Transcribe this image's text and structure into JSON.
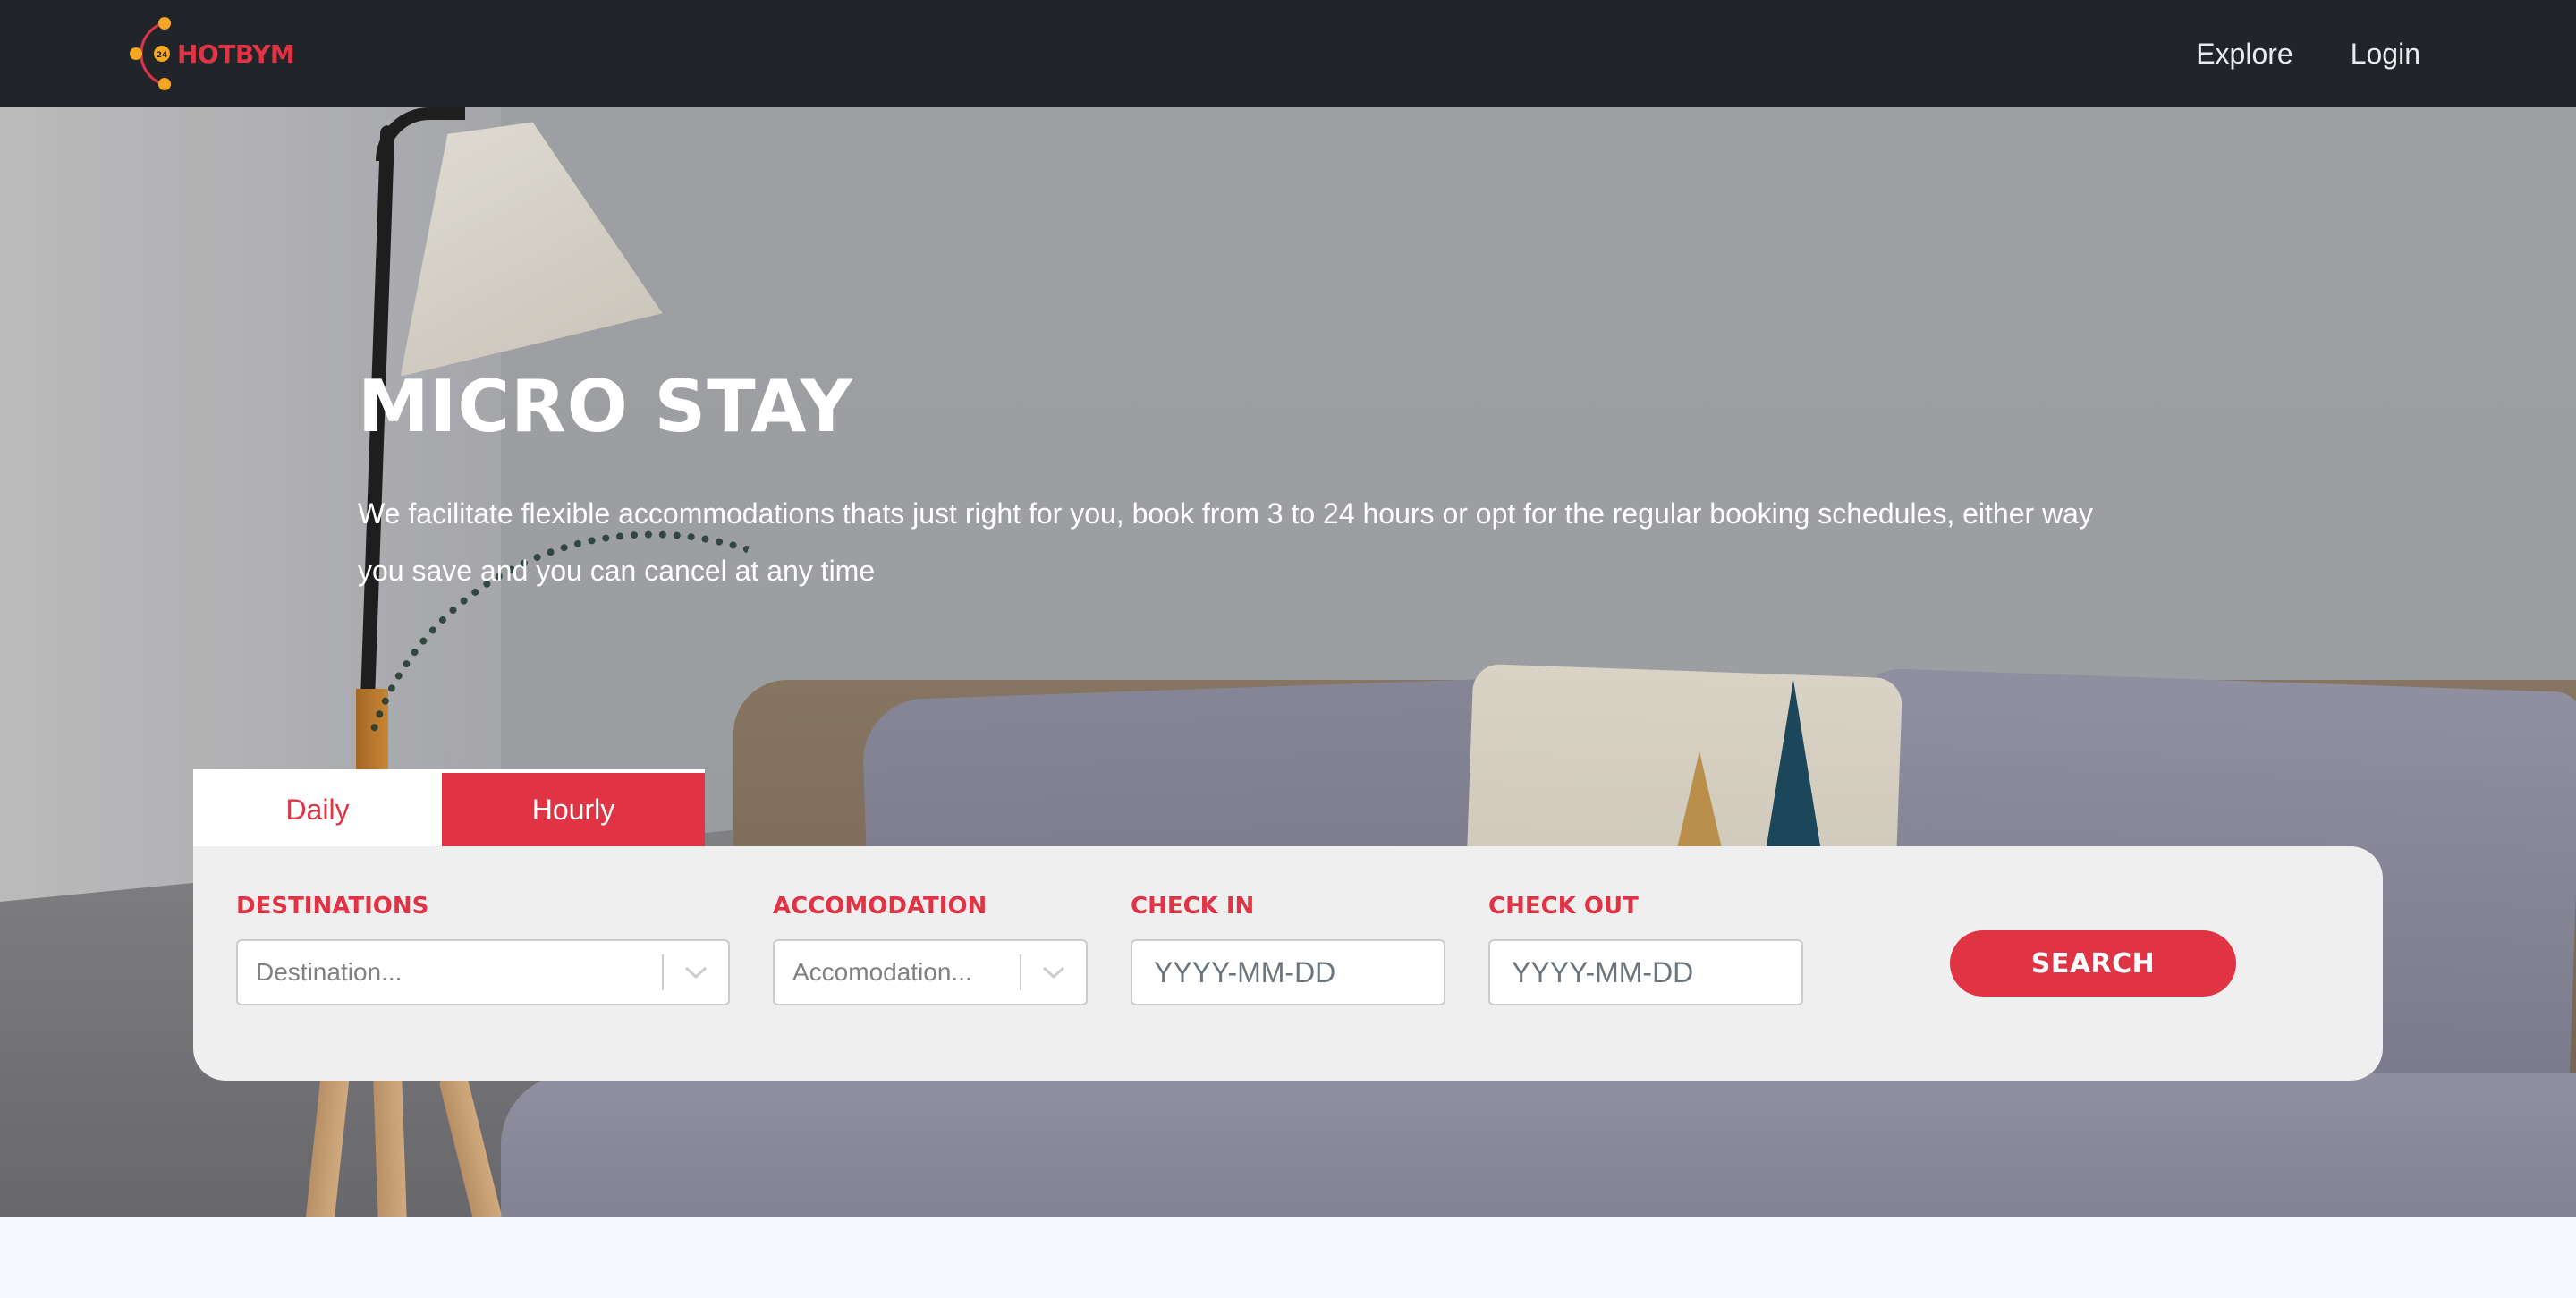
{
  "brand": {
    "name": "HOTBYM",
    "logo_center_text": "24",
    "colors": {
      "primary": "#e03444",
      "logo_accent": "#f5a623",
      "navbar": "#212429"
    }
  },
  "nav": {
    "explore_label": "Explore",
    "login_label": "Login"
  },
  "hero": {
    "title": "MICRO STAY",
    "description": "We facilitate flexible accommodations thats just right for you, book from 3 to 24 hours or opt for the regular booking schedules, either way you save and you can cancel at any time"
  },
  "booking": {
    "tabs": [
      {
        "label": "Daily",
        "active": false
      },
      {
        "label": "Hourly",
        "active": true
      }
    ],
    "destinations": {
      "label": "DESTINATIONS",
      "placeholder": "Destination...",
      "icon": "chevron-down-icon"
    },
    "accommodation": {
      "label": "ACCOMODATION",
      "placeholder": "Accomodation...",
      "icon": "chevron-down-icon"
    },
    "check_in": {
      "label": "CHECK IN",
      "placeholder": "YYYY-MM-DD"
    },
    "check_out": {
      "label": "CHECK OUT",
      "placeholder": "YYYY-MM-DD"
    },
    "search_label": "SEARCH"
  }
}
